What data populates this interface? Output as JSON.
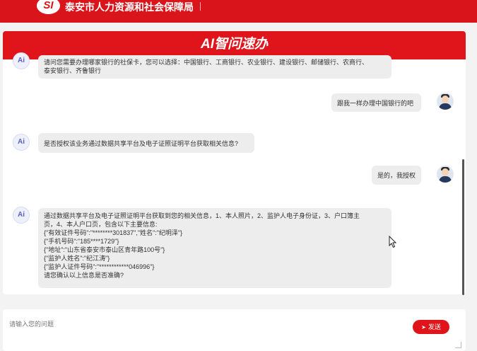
{
  "header": {
    "logo_text": "SI",
    "org_name": "泰安市人力资源和社会保障局"
  },
  "banner": {
    "title": "AI智问速办"
  },
  "icons": {
    "ai_avatar": "ai-logo-icon",
    "user_avatar": "user-avatar-icon",
    "send": "paper-plane-icon"
  },
  "messages": [
    {
      "role": "ai",
      "lines": [
        "请问您需要办理哪家银行的社保卡，您可以选择：中国银行、工商银行、农业银行、建设银行、邮储银行、农商行、",
        "泰安银行、齐鲁银行"
      ]
    },
    {
      "role": "user",
      "text": "跟我一样办理中国银行的吧"
    },
    {
      "role": "ai",
      "lines": [
        "是否授权该业务通过数据共享平台及电子证照证明平台获取相关信息?"
      ]
    },
    {
      "role": "user",
      "text": "是的，我授权"
    },
    {
      "role": "ai",
      "lines": [
        "通过数据共享平台及电子证照证明平台获取到您的相关信息，1、本人照片，2、监护人电子身份证，3、户口簿主",
        "页，4、本人户口页，包含以下主要信息:",
        "{\"有效证件号码\":\"********301837\",\"姓名\":\"纪明泽\"}",
        "{\"手机号码\":\"185****1729\"}",
        "{\"地址\":\"山东省泰安市泰山区青年路100号\"}",
        "{\"监护人姓名\":\"纪江涛\"}",
        "{\"监护人证件号码\":\"************046996\"}",
        "请您确认以上信息是否准确?"
      ]
    }
  ],
  "input": {
    "placeholder": "请输入您的问题",
    "value": ""
  },
  "send_button": {
    "label": "发送"
  },
  "colors": {
    "brand_red": "#d9141b",
    "bubble_bg": "#ededed"
  }
}
